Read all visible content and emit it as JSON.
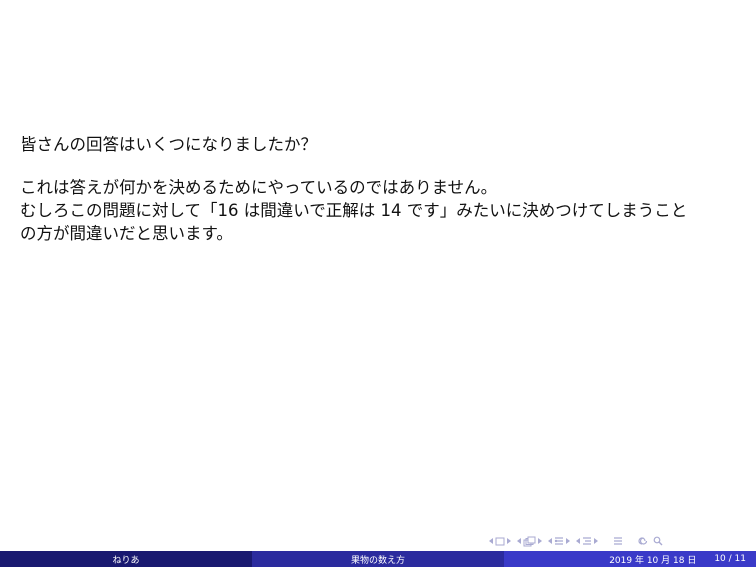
{
  "body": {
    "question": "皆さんの回答はいくつになりましたか？",
    "para_line1": "これは答えが何かを決めるためにやっているのではありません。",
    "para_line2": "むしろこの問題に対して「16 は間違いで正解は 14 です」みたいに決めつけてしまうこと",
    "para_line3": "の方が間違いだと思います。"
  },
  "navigation": {
    "icons": [
      "prev-slide-arrow-icon",
      "slide-icon",
      "next-slide-arrow-icon",
      "prev-frame-arrow-icon",
      "frame-icon",
      "next-frame-arrow-icon",
      "prev-subsection-arrow-icon",
      "subsection-icon",
      "next-subsection-arrow-icon",
      "prev-section-arrow-icon",
      "section-icon",
      "next-section-arrow-icon",
      "document-icon",
      "back-icon",
      "search-icon"
    ]
  },
  "footline": {
    "author": "ねりあ",
    "title": "果物の数え方",
    "date": "2019 年 10 月 18 日",
    "page": "10 / 11",
    "colors": {
      "author_bg": "#191970",
      "title_bg": "#2b2b9e",
      "date_bg": "#3a3ac8",
      "nav": "#a9aad2"
    }
  }
}
